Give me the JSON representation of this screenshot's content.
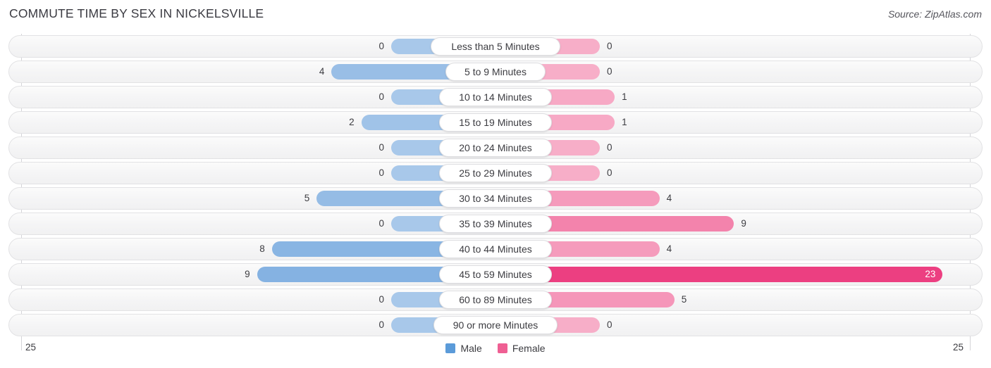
{
  "header": {
    "title": "COMMUTE TIME BY SEX IN NICKELSVILLE",
    "source": "Source: ZipAtlas.com"
  },
  "legend": {
    "items": [
      {
        "label": "Male",
        "color": "#5b9bd9"
      },
      {
        "label": "Female",
        "color": "#ef5f93"
      }
    ]
  },
  "axis": {
    "left_tick": "25",
    "right_tick": "25"
  },
  "chart_data": {
    "type": "bar",
    "subtype": "diverging-bidirectional",
    "title": "COMMUTE TIME BY SEX IN NICKELSVILLE",
    "xlabel": "",
    "ylabel": "",
    "xlim": [
      25,
      25
    ],
    "axis_ticks": [
      "25",
      "25"
    ],
    "grid": true,
    "legend_position": "bottom-center",
    "categories": [
      "Less than 5 Minutes",
      "5 to 9 Minutes",
      "10 to 14 Minutes",
      "15 to 19 Minutes",
      "20 to 24 Minutes",
      "25 to 29 Minutes",
      "30 to 34 Minutes",
      "35 to 39 Minutes",
      "40 to 44 Minutes",
      "45 to 59 Minutes",
      "60 to 89 Minutes",
      "90 or more Minutes"
    ],
    "series": [
      {
        "name": "Male",
        "direction": "left",
        "color": "#5b9bd9",
        "values": [
          0,
          4,
          0,
          2,
          0,
          0,
          5,
          0,
          8,
          9,
          0,
          0
        ]
      },
      {
        "name": "Female",
        "direction": "right",
        "color": "#ef5f93",
        "values": [
          0,
          0,
          1,
          1,
          0,
          0,
          4,
          9,
          4,
          23,
          5,
          0
        ]
      }
    ]
  },
  "rows": [
    {
      "category": "Less than 5 Minutes",
      "male": "0",
      "female": "0"
    },
    {
      "category": "5 to 9 Minutes",
      "male": "4",
      "female": "0"
    },
    {
      "category": "10 to 14 Minutes",
      "male": "0",
      "female": "1"
    },
    {
      "category": "15 to 19 Minutes",
      "male": "2",
      "female": "1"
    },
    {
      "category": "20 to 24 Minutes",
      "male": "0",
      "female": "0"
    },
    {
      "category": "25 to 29 Minutes",
      "male": "0",
      "female": "0"
    },
    {
      "category": "30 to 34 Minutes",
      "male": "5",
      "female": "4"
    },
    {
      "category": "35 to 39 Minutes",
      "male": "0",
      "female": "9"
    },
    {
      "category": "40 to 44 Minutes",
      "male": "8",
      "female": "4"
    },
    {
      "category": "45 to 59 Minutes",
      "male": "9",
      "female": "23"
    },
    {
      "category": "60 to 89 Minutes",
      "male": "0",
      "female": "5"
    },
    {
      "category": "90 or more Minutes",
      "male": "0",
      "female": "0"
    }
  ]
}
